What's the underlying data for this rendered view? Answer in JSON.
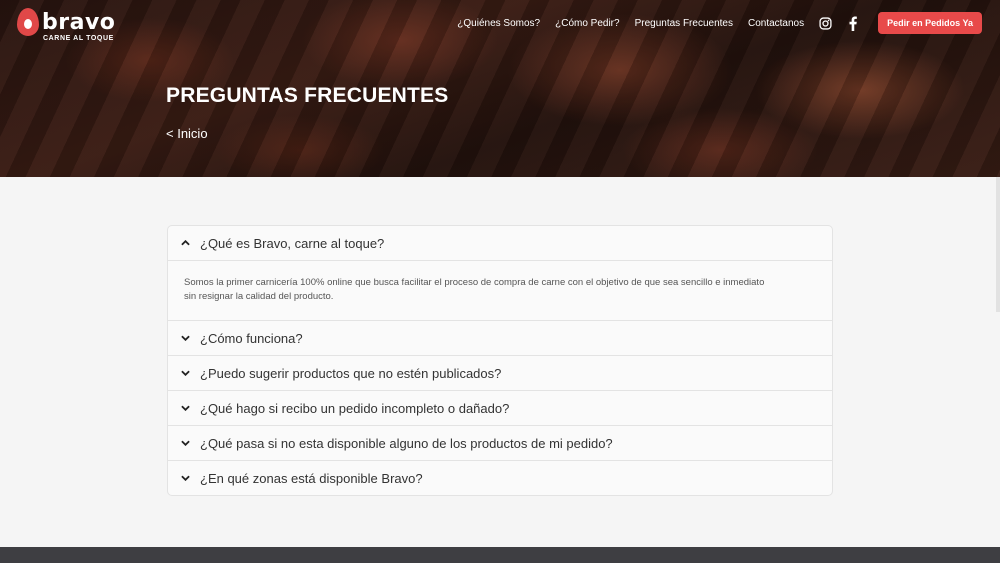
{
  "brand": {
    "name": "bravo",
    "tagline": "CARNE AL TOQUE",
    "color": "#e04848"
  },
  "nav": {
    "links": [
      "¿Quiénes Somos?",
      "¿Cómo Pedir?",
      "Preguntas Frecuentes",
      "Contactanos"
    ],
    "icons": [
      "instagram-icon",
      "facebook-icon"
    ],
    "cta": "Pedir en Pedidos Ya",
    "cta_color": "#e84a4a"
  },
  "hero": {
    "title": "PREGUNTAS FRECUENTES",
    "back": "< Inicio"
  },
  "faq": {
    "items": [
      {
        "question": "¿Qué es Bravo, carne al toque?",
        "expanded": true,
        "answer": "Somos la primer carnicería 100% online que busca facilitar el proceso de compra de carne con el objetivo de que sea sencillo e inmediato sin resignar la calidad del producto."
      },
      {
        "question": "¿Cómo funciona?",
        "expanded": false
      },
      {
        "question": "¿Puedo sugerir productos que no estén publicados?",
        "expanded": false
      },
      {
        "question": "¿Qué hago si recibo un pedido incompleto o dañado?",
        "expanded": false
      },
      {
        "question": "¿Qué pasa si no esta disponible alguno de los productos de mi pedido?",
        "expanded": false
      },
      {
        "question": "¿En qué zonas está disponible Bravo?",
        "expanded": false
      }
    ]
  }
}
